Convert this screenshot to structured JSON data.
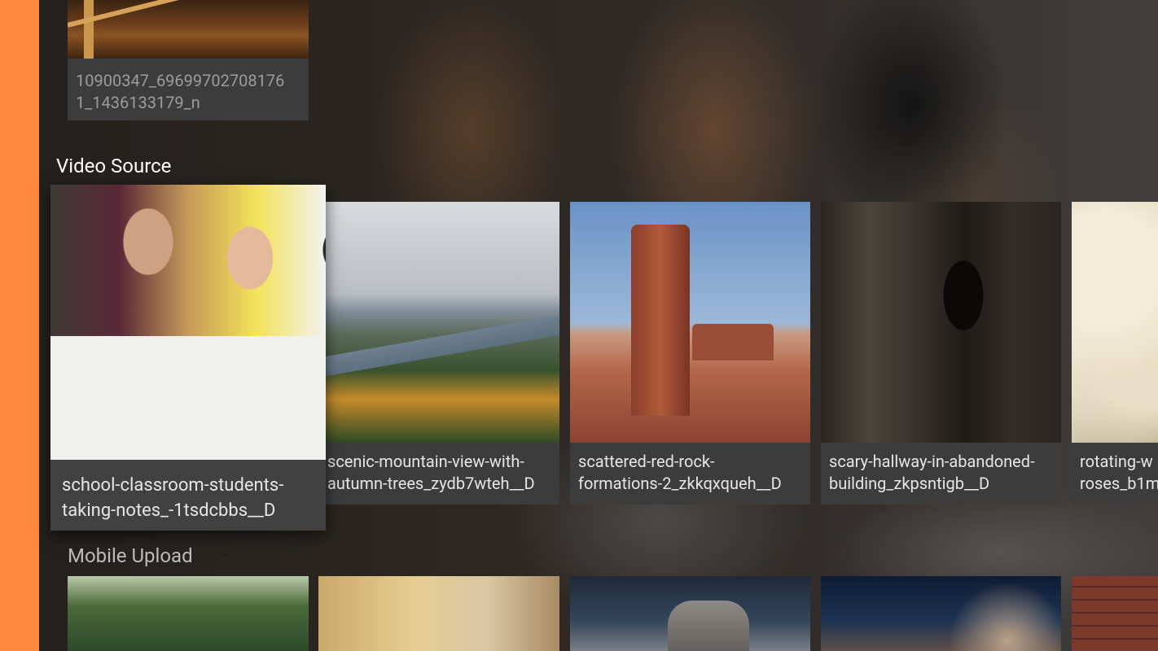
{
  "rows": {
    "top_partial": {
      "items": [
        {
          "title": "10900347_69699702708176\n1_1436133179_n"
        }
      ]
    },
    "video_source": {
      "label": "Video Source",
      "items": [
        {
          "title": "school-classroom-students-\ntaking-notes_-1tsdcbbs__D"
        },
        {
          "title": "scenic-mountain-view-with-\nautumn-trees_zydb7wteh__D"
        },
        {
          "title": "scattered-red-rock-\nformations-2_zkkqxqueh__D"
        },
        {
          "title": "scary-hallway-in-abandoned-\nbuilding_zkpsntigb__D"
        },
        {
          "title": "rotating-w\nroses_b1m"
        }
      ]
    },
    "mobile_upload": {
      "label": "Mobile Upload"
    }
  },
  "colors": {
    "accent": "#ff8a3d",
    "card_bg": "#3c3c3c",
    "text": "#e6e6e6"
  }
}
